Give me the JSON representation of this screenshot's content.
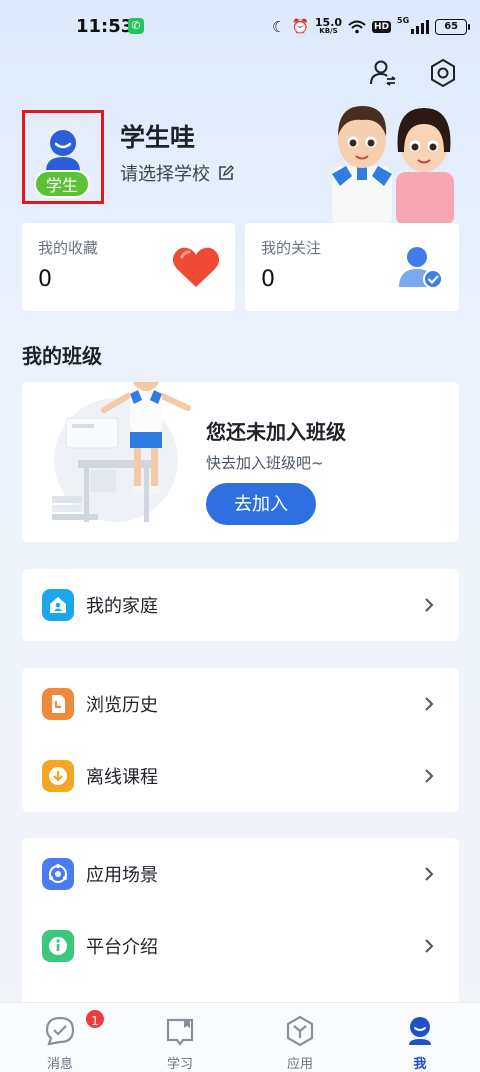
{
  "status_bar": {
    "time": "11:53",
    "net_speed_value": "15.0",
    "net_speed_unit": "KB/S",
    "hd": "HD",
    "network": "5G",
    "battery": "65"
  },
  "header": {
    "account_switch_icon": "account-switch-icon",
    "settings_icon": "gear-icon"
  },
  "profile": {
    "name": "学生哇",
    "role_badge": "学生",
    "school_placeholder": "请选择学校"
  },
  "stats": {
    "favorites": {
      "label": "我的收藏",
      "value": "0",
      "icon": "heart-icon"
    },
    "following": {
      "label": "我的关注",
      "value": "0",
      "icon": "user-check-icon"
    }
  },
  "class_section": {
    "title": "我的班级",
    "empty_title": "您还未加入班级",
    "empty_subtitle": "快去加入班级吧~",
    "join_button": "去加入"
  },
  "menu": {
    "family": {
      "label": "我的家庭",
      "icon": "home-icon",
      "color": "#1ba7e8"
    },
    "history": {
      "label": "浏览历史",
      "icon": "history-icon",
      "color": "#f08a3a"
    },
    "offline": {
      "label": "离线课程",
      "icon": "download-icon",
      "color": "#f5a623"
    },
    "scenes": {
      "label": "应用场景",
      "icon": "scene-icon",
      "color": "#4a7bf0"
    },
    "about": {
      "label": "平台介绍",
      "icon": "info-icon",
      "color": "#3cc87a"
    }
  },
  "tab_bar": {
    "messages": {
      "label": "消息",
      "badge": "1"
    },
    "study": {
      "label": "学习"
    },
    "apps": {
      "label": "应用"
    },
    "me": {
      "label": "我"
    },
    "active_color": "#1f4fc9"
  }
}
